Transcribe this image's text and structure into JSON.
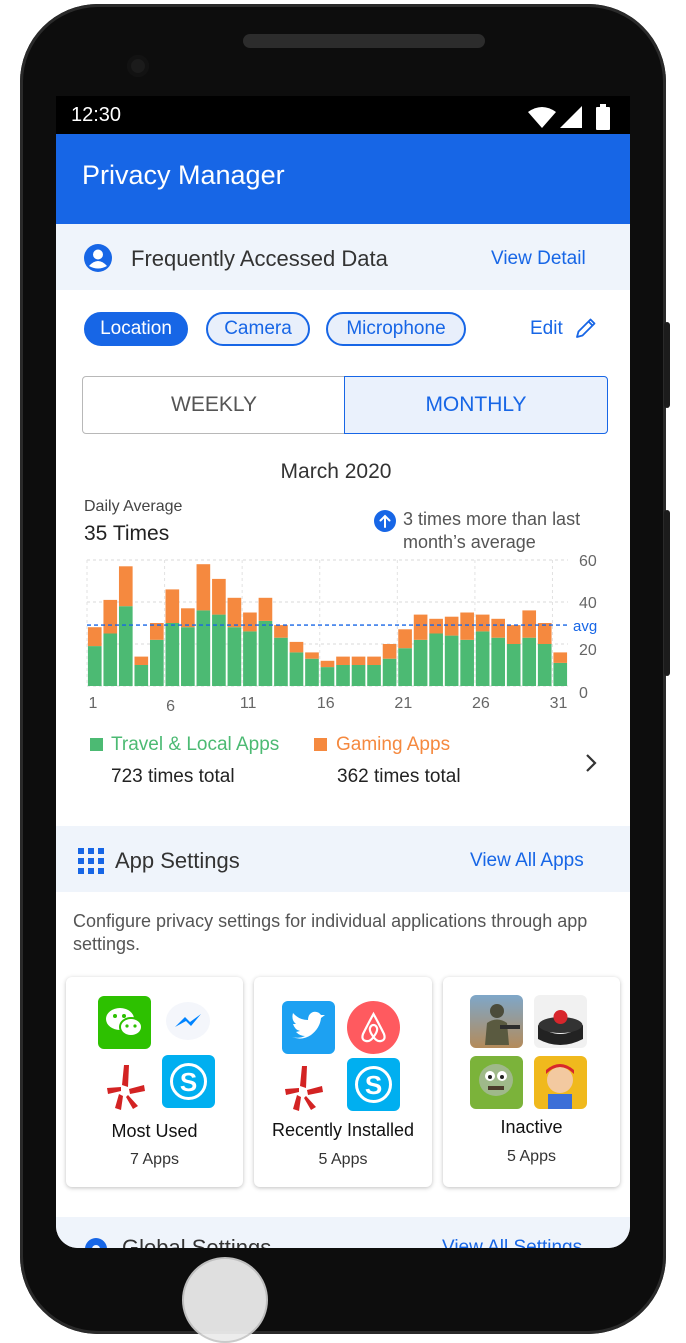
{
  "status": {
    "time": "12:30"
  },
  "app": {
    "title": "Privacy Manager"
  },
  "frequent": {
    "title": "Frequently Accessed Data",
    "link": "View Detail",
    "chips": [
      "Location",
      "Camera",
      "Microphone"
    ],
    "edit": "Edit",
    "tabs": {
      "weekly": "WEEKLY",
      "monthly": "MONTHLY",
      "selected": "MONTHLY"
    }
  },
  "chart_data": {
    "type": "bar",
    "title": "March 2020",
    "daily_avg_label": "Daily Average",
    "daily_avg_value": "35 Times",
    "note": "3 times more than last month’s average",
    "x": [
      1,
      2,
      3,
      4,
      5,
      6,
      7,
      8,
      9,
      10,
      11,
      12,
      13,
      14,
      15,
      16,
      17,
      18,
      19,
      20,
      21,
      22,
      23,
      24,
      25,
      26,
      27,
      28,
      29,
      30,
      31
    ],
    "x_ticks": [
      "1",
      "6",
      "11",
      "16",
      "21",
      "26",
      "31"
    ],
    "y_ticks": [
      "60",
      "40",
      "20",
      "0"
    ],
    "ylim": [
      0,
      60
    ],
    "avg_line": {
      "value": 29,
      "label": "avg"
    },
    "series": [
      {
        "name": "Travel & Local Apps",
        "color": "#4cba73",
        "values": [
          19,
          25,
          38,
          10,
          22,
          30,
          28,
          36,
          34,
          28,
          26,
          31,
          23,
          16,
          13,
          9,
          10,
          10,
          10,
          13,
          18,
          22,
          25,
          24,
          22,
          26,
          23,
          20,
          23,
          20,
          11
        ]
      },
      {
        "name": "Gaming Apps",
        "color": "#f5893f",
        "values": [
          9,
          16,
          19,
          4,
          8,
          16,
          9,
          22,
          17,
          14,
          9,
          11,
          6,
          5,
          3,
          3,
          4,
          4,
          4,
          7,
          9,
          12,
          7,
          9,
          13,
          8,
          9,
          9,
          13,
          10,
          5
        ]
      }
    ],
    "legend": [
      {
        "label": "Travel & Local Apps",
        "total": "723 times total",
        "color": "#4cba73"
      },
      {
        "label": "Gaming Apps",
        "total": "362 times total",
        "color": "#f5893f"
      }
    ]
  },
  "app_settings": {
    "title": "App Settings",
    "link": "View All Apps",
    "desc": "Configure privacy settings for individual applications through app settings.",
    "cards": [
      {
        "title": "Most Used",
        "count": "7 Apps",
        "icons": [
          "wechat-icon",
          "messenger-icon",
          "yelp-icon",
          "skype-icon"
        ]
      },
      {
        "title": "Recently Installed",
        "count": "5 Apps",
        "icons": [
          "twitter-icon",
          "airbnb-icon",
          "yelp-icon",
          "skype-icon"
        ]
      },
      {
        "title": "Inactive",
        "count": "5 Apps",
        "icons": [
          "pubg-icon",
          "red-button-app-icon",
          "plants-vs-zombies-icon",
          "subway-surfers-icon"
        ]
      }
    ]
  },
  "global_settings": {
    "title": "Global Settings",
    "link": "View All Settings"
  },
  "colors": {
    "accent": "#1766e6",
    "header_bg": "#eff4fb",
    "travel": "#4cba73",
    "gaming": "#f5893f"
  }
}
